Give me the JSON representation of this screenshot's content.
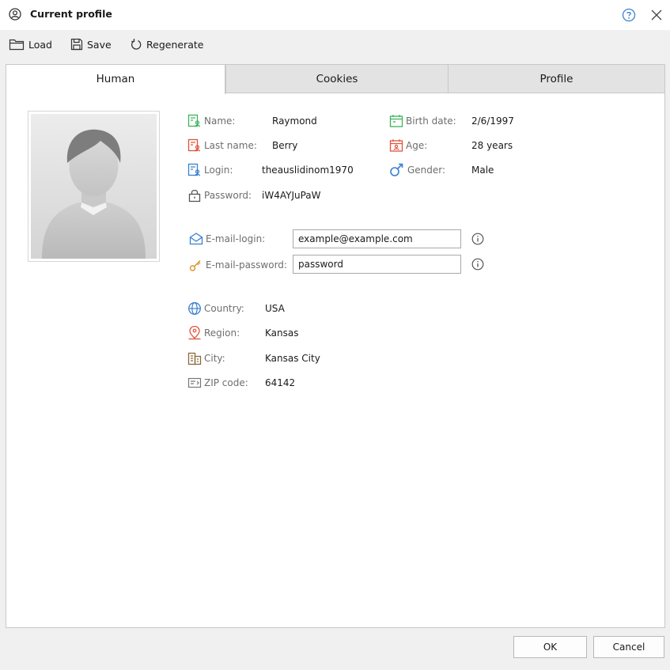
{
  "window": {
    "title": "Current profile"
  },
  "toolbar": {
    "load_label": "Load",
    "save_label": "Save",
    "regenerate_label": "Regenerate"
  },
  "tabs": [
    {
      "label": "Human",
      "active": true
    },
    {
      "label": "Cookies",
      "active": false
    },
    {
      "label": "Profile",
      "active": false
    }
  ],
  "human": {
    "name": {
      "label": "Name:",
      "value": "Raymond"
    },
    "last_name": {
      "label": "Last name:",
      "value": "Berry"
    },
    "login": {
      "label": "Login:",
      "value": "theauslidinom1970"
    },
    "password": {
      "label": "Password:",
      "value": "iW4AYJuPaW"
    },
    "birth_date": {
      "label": "Birth date:",
      "value": "2/6/1997"
    },
    "age": {
      "label": "Age:",
      "value": "28 years"
    },
    "gender": {
      "label": "Gender:",
      "value": "Male"
    },
    "email_login": {
      "label": "E-mail-login:",
      "value": "example@example.com"
    },
    "email_password": {
      "label": "E-mail-password:",
      "value": "password"
    },
    "country": {
      "label": "Country:",
      "value": "USA"
    },
    "region": {
      "label": "Region:",
      "value": "Kansas"
    },
    "city": {
      "label": "City:",
      "value": "Kansas City"
    },
    "zip": {
      "label": "ZIP code:",
      "value": "64142"
    }
  },
  "buttons": {
    "ok": "OK",
    "cancel": "Cancel"
  },
  "colors": {
    "green": "#3cb45a",
    "red": "#e0533c",
    "blue": "#3a7fd0",
    "gray_icon": "#6e6e6e",
    "key": "#d9922a"
  }
}
